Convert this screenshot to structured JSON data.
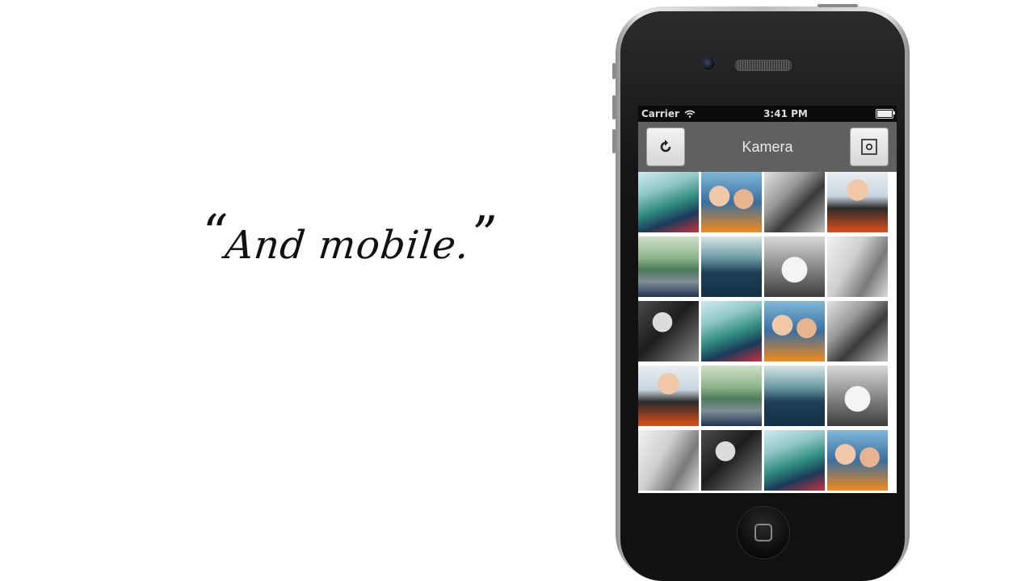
{
  "slide": {
    "quote_open": "“",
    "quote_text": "And mobile.",
    "quote_close": "”"
  },
  "statusbar": {
    "carrier": "Carrier",
    "time": "3:41 PM",
    "battery_level": 1.0
  },
  "navbar": {
    "title": "Kamera",
    "left_icon": "refresh-icon",
    "right_icon": "capture-icon"
  },
  "photos": [
    {
      "icon": "photo-ferry-selfie"
    },
    {
      "icon": "photo-couple-selfie"
    },
    {
      "icon": "photo-bw-sitting"
    },
    {
      "icon": "photo-camera-man"
    },
    {
      "icon": "photo-road"
    },
    {
      "icon": "photo-lake"
    },
    {
      "icon": "photo-dog"
    },
    {
      "icon": "photo-bw-deck"
    },
    {
      "icon": "photo-bw-woman"
    },
    {
      "icon": "photo-ferry-selfie"
    },
    {
      "icon": "photo-couple-selfie"
    },
    {
      "icon": "photo-bw-sitting"
    },
    {
      "icon": "photo-camera-man"
    },
    {
      "icon": "photo-road"
    },
    {
      "icon": "photo-lake"
    },
    {
      "icon": "photo-dog"
    },
    {
      "icon": "photo-bw-deck"
    },
    {
      "icon": "photo-bw-woman"
    },
    {
      "icon": "photo-ferry-selfie"
    },
    {
      "icon": "photo-couple-selfie"
    }
  ],
  "colors": {
    "navbar_bg": "#606060",
    "statusbar_bg": "#0b0b0b",
    "phone_body": "#111111"
  }
}
